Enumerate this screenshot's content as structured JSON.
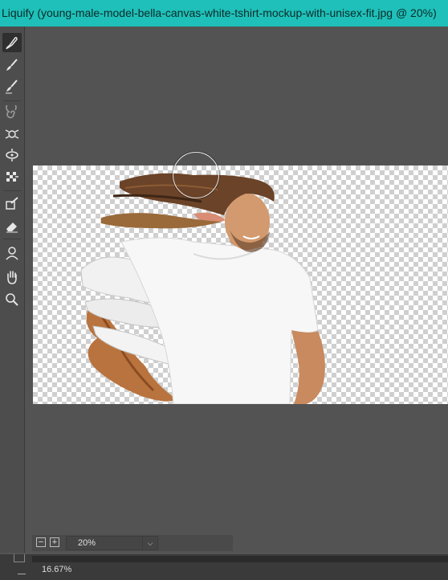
{
  "window": {
    "title": "Liquify (young-male-model-bella-canvas-white-tshirt-mockup-with-unisex-fit.jpg @ 20%)"
  },
  "toolbar": {
    "tools": [
      {
        "name": "forward-warp-tool",
        "icon": "warp-brush-icon",
        "active": true
      },
      {
        "name": "reconstruct-tool",
        "icon": "reconstruct-brush-icon"
      },
      {
        "name": "smooth-tool",
        "icon": "smooth-brush-icon"
      },
      {
        "name": "twirl-tool",
        "icon": "twirl-icon"
      },
      {
        "name": "pucker-tool",
        "icon": "pucker-icon"
      },
      {
        "name": "bloat-tool",
        "icon": "bloat-icon"
      },
      {
        "name": "push-left-tool",
        "icon": "push-left-icon"
      },
      {
        "name": "freeze-mask-tool",
        "icon": "freeze-mask-icon"
      },
      {
        "name": "thaw-mask-tool",
        "icon": "thaw-mask-icon"
      },
      {
        "name": "face-tool",
        "icon": "face-tool-icon"
      },
      {
        "name": "hand-tool",
        "icon": "hand-icon"
      },
      {
        "name": "zoom-tool",
        "icon": "zoom-icon"
      }
    ]
  },
  "zoom_controls": {
    "minus": "−",
    "plus": "+",
    "value": "20%"
  },
  "statusbar": {
    "zoom": "16.67%"
  },
  "colors": {
    "title_bar": "#1fc0b9",
    "workspace": "#535353",
    "toolbar": "#4d4d4d"
  }
}
